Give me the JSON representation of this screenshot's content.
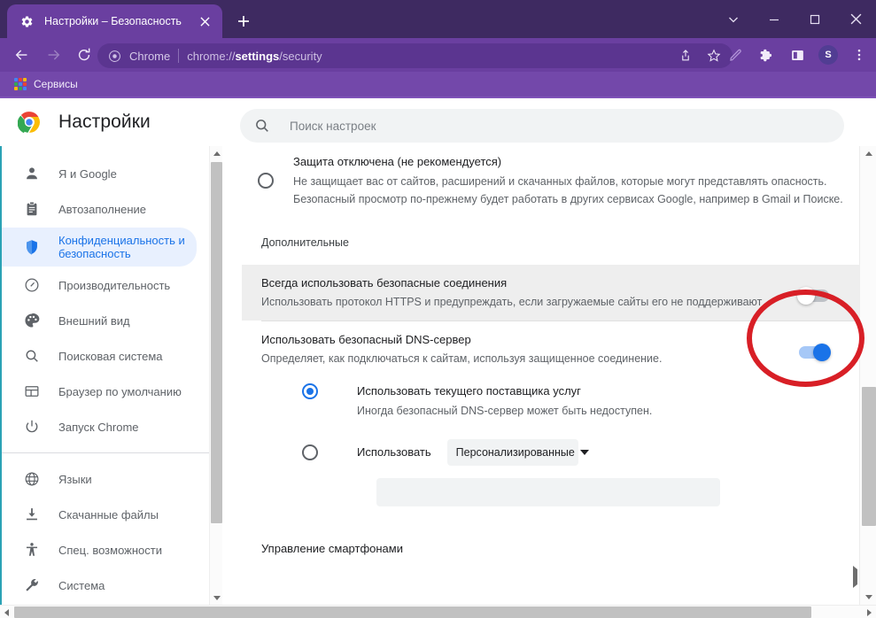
{
  "window": {
    "controls": {
      "chevron_label": "⌄",
      "minimize_label": "—",
      "maximize_label": "□",
      "close_label": "✕"
    }
  },
  "tabstrip": {
    "tab": {
      "title": "Настройки – Безопасность",
      "favicon": "gear-icon",
      "close_label": "✕"
    },
    "new_tab_label": "+"
  },
  "toolbar": {
    "back_label": "←",
    "forward_label": "→",
    "reload_label": "⟳",
    "omnibox": {
      "brand": "Chrome",
      "url_prefix": "chrome://",
      "url_bold": "settings",
      "url_suffix": "/security"
    },
    "share_label": "share-icon",
    "bookmark_label": "star-icon",
    "pen_label": "pen-icon",
    "extensions_label": "puzzle-icon",
    "sidepanel_label": "side-panel-icon",
    "avatar_letter": "S",
    "menu_label": "⋮"
  },
  "bookmarks": {
    "items": [
      {
        "label": "Сервисы",
        "icon": "apps-grid-icon"
      }
    ]
  },
  "settings_header": {
    "title": "Настройки",
    "logo": "chrome-logo",
    "search_placeholder": "Поиск настроек",
    "search_value": ""
  },
  "sidebar": {
    "groups": [
      {
        "items": [
          {
            "label": "Я и Google",
            "icon": "person-icon",
            "active": false
          },
          {
            "label": "Автозаполнение",
            "icon": "clipboard-icon",
            "active": false
          },
          {
            "label": "Конфиденциальность и\nбезопасность",
            "icon": "shield-icon",
            "active": true
          },
          {
            "label": "Производительность",
            "icon": "speedometer-icon",
            "active": false
          },
          {
            "label": "Внешний вид",
            "icon": "palette-icon",
            "active": false
          },
          {
            "label": "Поисковая система",
            "icon": "search-icon",
            "active": false
          },
          {
            "label": "Браузер по умолчанию",
            "icon": "browser-window-icon",
            "active": false
          },
          {
            "label": "Запуск Chrome",
            "icon": "power-icon",
            "active": false
          }
        ]
      },
      {
        "items": [
          {
            "label": "Языки",
            "icon": "globe-icon",
            "active": false
          },
          {
            "label": "Скачанные файлы",
            "icon": "download-icon",
            "active": false
          },
          {
            "label": "Спец. возможности",
            "icon": "accessibility-icon",
            "active": false
          },
          {
            "label": "Система",
            "icon": "wrench-icon",
            "active": false
          }
        ]
      }
    ]
  },
  "main": {
    "protection_option": {
      "title": "Защита отключена (не рекомендуется)",
      "description": "Не защищает вас от сайтов, расширений и скачанных файлов, которые могут представлять опасность. Безопасный просмотр по-прежнему будет работать в других сервисах Google, например в Gmail и Поиске.",
      "selected": false
    },
    "advanced_section_label": "Дополнительные",
    "https_row": {
      "title": "Всегда использовать безопасные соединения",
      "description": "Использовать протокол HTTPS и предупреждать, если загружаемые сайты его не поддерживают",
      "toggle_state": "off",
      "highlighted": true
    },
    "dns_row": {
      "title": "Использовать безопасный DNS-сервер",
      "description": "Определяет, как подключаться к сайтам, используя защищенное соединение.",
      "toggle_state": "on"
    },
    "dns_options": [
      {
        "label": "Использовать текущего поставщика услуг",
        "description": "Иногда безопасный DNS-сервер может быть недоступен.",
        "selected": true
      },
      {
        "label": "Использовать",
        "description": "",
        "selected": false,
        "dropdown_value": "Персонализированные",
        "custom_input_value": "",
        "custom_input_placeholder": ""
      }
    ],
    "bottom_section_label": "Управление смартфонами"
  },
  "annotation": {
    "shape": "ellipse",
    "color": "#d81f26",
    "target": "https-toggle"
  },
  "colors": {
    "tabstrip_bg": "#3e2a61",
    "tab_active_bg": "#6a3fa0",
    "toolbar_bg": "#6a3fa0",
    "bookmarkbar_bg": "#7348aa",
    "accent_blue": "#1a73e8",
    "nav_active_bg": "#e8f0fe",
    "annotation_red": "#d81f26"
  }
}
